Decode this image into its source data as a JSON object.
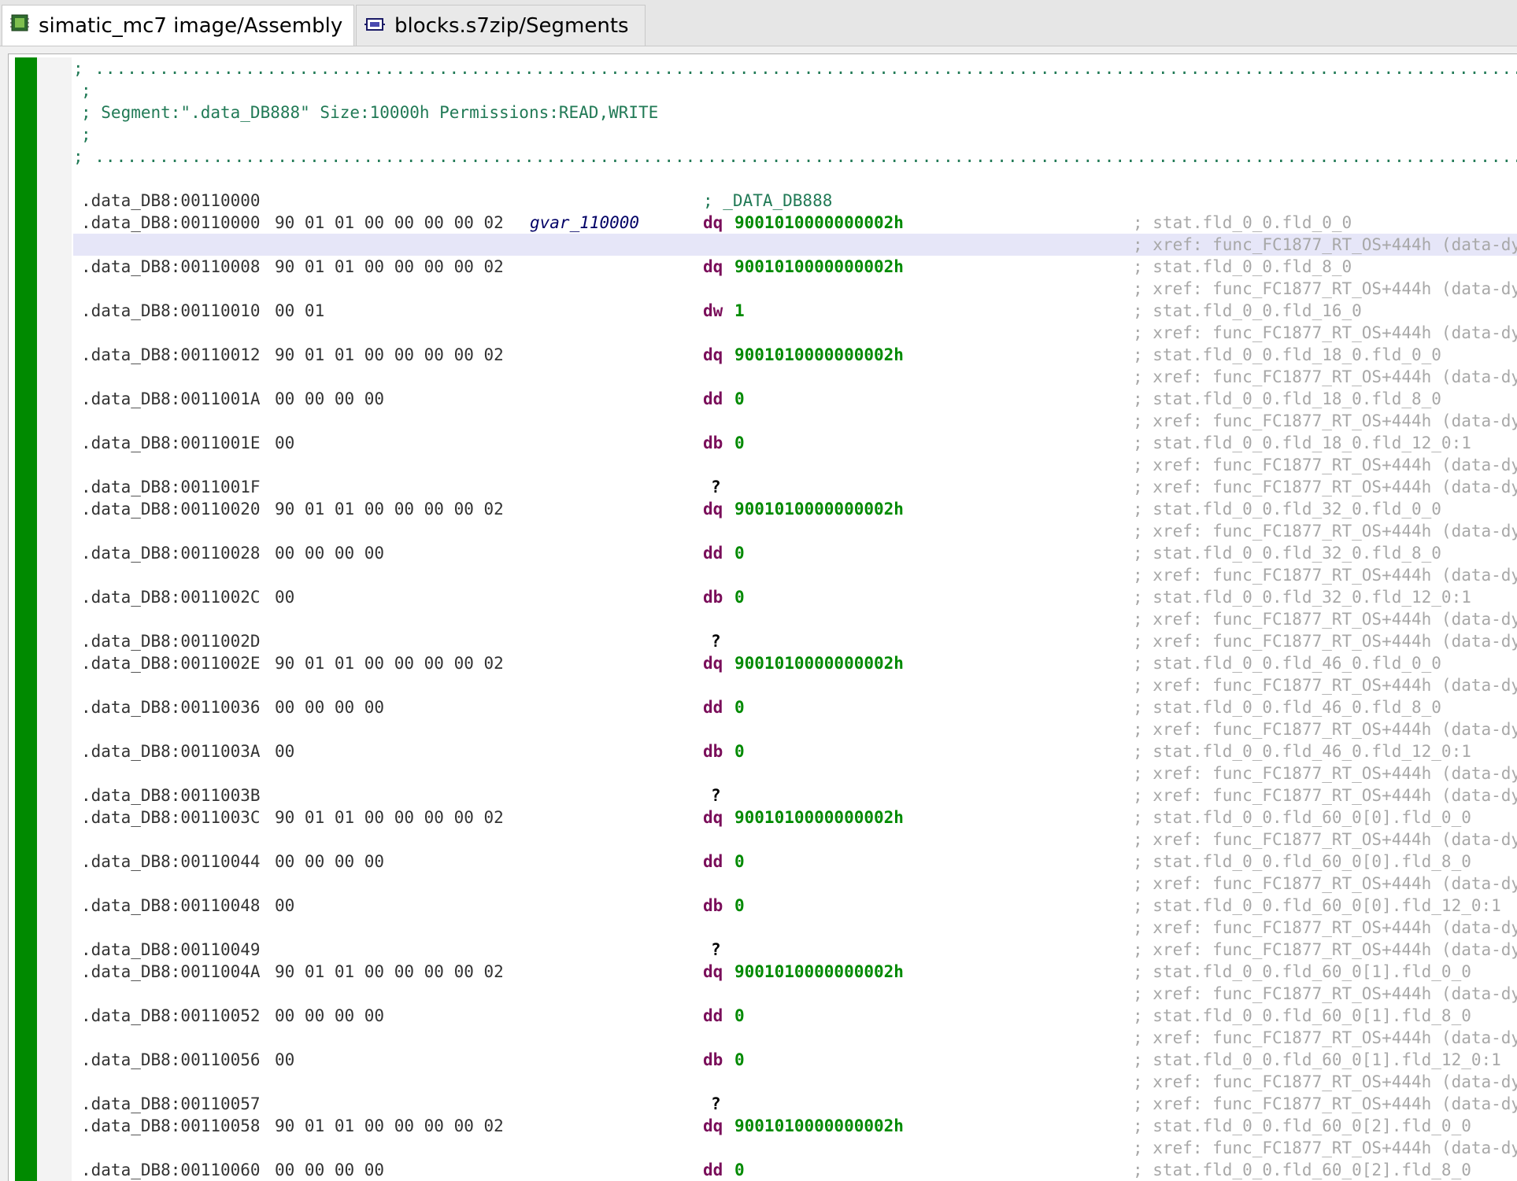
{
  "tabs": [
    {
      "label": "simatic_mc7 image/Assembly",
      "icon": "cpu-chip-icon",
      "active": true,
      "close_icon": "close-icon"
    },
    {
      "label": "blocks.s7zip/Segments",
      "icon": "segments-icon",
      "active": false
    }
  ],
  "header": {
    "dots": "; ..............................................................................................................................................",
    "semicolon": ";",
    "segment_text": "; Segment:\".data_DB888\" Size:10000h Permissions:READ,WRITE"
  },
  "section_label": "; _DATA_DB888",
  "rows": [
    {
      "addr": ".data_DB8:00110000",
      "bytes": "",
      "label": "",
      "mnem": "",
      "val": "",
      "cmt": ""
    },
    {
      "addr": ".data_DB8:00110000",
      "bytes": "90 01 01 00 00 00 00 02",
      "label": "gvar_110000",
      "mnem": "dq",
      "val": "9001010000000002h",
      "cmt": "; stat.fld_0_0.fld_0_0"
    },
    {
      "addr": "",
      "bytes": "",
      "label": "",
      "mnem": "",
      "val": "",
      "cmt": "; xref: func_FC1877_RT_OS+444h (data-dy"
    },
    {
      "addr": ".data_DB8:00110008",
      "bytes": "90 01 01 00 00 00 00 02",
      "label": "",
      "mnem": "dq",
      "val": "9001010000000002h",
      "cmt": "; stat.fld_0_0.fld_8_0"
    },
    {
      "addr": "",
      "bytes": "",
      "label": "",
      "mnem": "",
      "val": "",
      "cmt": "; xref: func_FC1877_RT_OS+444h (data-dy"
    },
    {
      "addr": ".data_DB8:00110010",
      "bytes": "00 01",
      "label": "",
      "mnem": "dw",
      "val": "1",
      "cmt": "; stat.fld_0_0.fld_16_0"
    },
    {
      "addr": "",
      "bytes": "",
      "label": "",
      "mnem": "",
      "val": "",
      "cmt": "; xref: func_FC1877_RT_OS+444h (data-dy"
    },
    {
      "addr": ".data_DB8:00110012",
      "bytes": "90 01 01 00 00 00 00 02",
      "label": "",
      "mnem": "dq",
      "val": "9001010000000002h",
      "cmt": "; stat.fld_0_0.fld_18_0.fld_0_0"
    },
    {
      "addr": "",
      "bytes": "",
      "label": "",
      "mnem": "",
      "val": "",
      "cmt": "; xref: func_FC1877_RT_OS+444h (data-dy"
    },
    {
      "addr": ".data_DB8:0011001A",
      "bytes": "00 00 00 00",
      "label": "",
      "mnem": "dd",
      "val": "0",
      "cmt": "; stat.fld_0_0.fld_18_0.fld_8_0"
    },
    {
      "addr": "",
      "bytes": "",
      "label": "",
      "mnem": "",
      "val": "",
      "cmt": "; xref: func_FC1877_RT_OS+444h (data-dy"
    },
    {
      "addr": ".data_DB8:0011001E",
      "bytes": "00",
      "label": "",
      "mnem": "db",
      "val": "0",
      "cmt": "; stat.fld_0_0.fld_18_0.fld_12_0:1"
    },
    {
      "addr": "",
      "bytes": "",
      "label": "",
      "mnem": "",
      "val": "",
      "cmt": "; xref: func_FC1877_RT_OS+444h (data-dy"
    },
    {
      "addr": ".data_DB8:0011001F",
      "bytes": "",
      "label": "",
      "mnem": "?",
      "val": "",
      "cmt": "; xref: func_FC1877_RT_OS+444h (data-dy"
    },
    {
      "addr": ".data_DB8:00110020",
      "bytes": "90 01 01 00 00 00 00 02",
      "label": "",
      "mnem": "dq",
      "val": "9001010000000002h",
      "cmt": "; stat.fld_0_0.fld_32_0.fld_0_0"
    },
    {
      "addr": "",
      "bytes": "",
      "label": "",
      "mnem": "",
      "val": "",
      "cmt": "; xref: func_FC1877_RT_OS+444h (data-dy"
    },
    {
      "addr": ".data_DB8:00110028",
      "bytes": "00 00 00 00",
      "label": "",
      "mnem": "dd",
      "val": "0",
      "cmt": "; stat.fld_0_0.fld_32_0.fld_8_0"
    },
    {
      "addr": "",
      "bytes": "",
      "label": "",
      "mnem": "",
      "val": "",
      "cmt": "; xref: func_FC1877_RT_OS+444h (data-dy"
    },
    {
      "addr": ".data_DB8:0011002C",
      "bytes": "00",
      "label": "",
      "mnem": "db",
      "val": "0",
      "cmt": "; stat.fld_0_0.fld_32_0.fld_12_0:1"
    },
    {
      "addr": "",
      "bytes": "",
      "label": "",
      "mnem": "",
      "val": "",
      "cmt": "; xref: func_FC1877_RT_OS+444h (data-dy"
    },
    {
      "addr": ".data_DB8:0011002D",
      "bytes": "",
      "label": "",
      "mnem": "?",
      "val": "",
      "cmt": "; xref: func_FC1877_RT_OS+444h (data-dy"
    },
    {
      "addr": ".data_DB8:0011002E",
      "bytes": "90 01 01 00 00 00 00 02",
      "label": "",
      "mnem": "dq",
      "val": "9001010000000002h",
      "cmt": "; stat.fld_0_0.fld_46_0.fld_0_0"
    },
    {
      "addr": "",
      "bytes": "",
      "label": "",
      "mnem": "",
      "val": "",
      "cmt": "; xref: func_FC1877_RT_OS+444h (data-dy"
    },
    {
      "addr": ".data_DB8:00110036",
      "bytes": "00 00 00 00",
      "label": "",
      "mnem": "dd",
      "val": "0",
      "cmt": "; stat.fld_0_0.fld_46_0.fld_8_0"
    },
    {
      "addr": "",
      "bytes": "",
      "label": "",
      "mnem": "",
      "val": "",
      "cmt": "; xref: func_FC1877_RT_OS+444h (data-dy"
    },
    {
      "addr": ".data_DB8:0011003A",
      "bytes": "00",
      "label": "",
      "mnem": "db",
      "val": "0",
      "cmt": "; stat.fld_0_0.fld_46_0.fld_12_0:1"
    },
    {
      "addr": "",
      "bytes": "",
      "label": "",
      "mnem": "",
      "val": "",
      "cmt": "; xref: func_FC1877_RT_OS+444h (data-dy"
    },
    {
      "addr": ".data_DB8:0011003B",
      "bytes": "",
      "label": "",
      "mnem": "?",
      "val": "",
      "cmt": "; xref: func_FC1877_RT_OS+444h (data-dy"
    },
    {
      "addr": ".data_DB8:0011003C",
      "bytes": "90 01 01 00 00 00 00 02",
      "label": "",
      "mnem": "dq",
      "val": "9001010000000002h",
      "cmt": "; stat.fld_0_0.fld_60_0[0].fld_0_0"
    },
    {
      "addr": "",
      "bytes": "",
      "label": "",
      "mnem": "",
      "val": "",
      "cmt": "; xref: func_FC1877_RT_OS+444h (data-dy"
    },
    {
      "addr": ".data_DB8:00110044",
      "bytes": "00 00 00 00",
      "label": "",
      "mnem": "dd",
      "val": "0",
      "cmt": "; stat.fld_0_0.fld_60_0[0].fld_8_0"
    },
    {
      "addr": "",
      "bytes": "",
      "label": "",
      "mnem": "",
      "val": "",
      "cmt": "; xref: func_FC1877_RT_OS+444h (data-dy"
    },
    {
      "addr": ".data_DB8:00110048",
      "bytes": "00",
      "label": "",
      "mnem": "db",
      "val": "0",
      "cmt": "; stat.fld_0_0.fld_60_0[0].fld_12_0:1"
    },
    {
      "addr": "",
      "bytes": "",
      "label": "",
      "mnem": "",
      "val": "",
      "cmt": "; xref: func_FC1877_RT_OS+444h (data-dy"
    },
    {
      "addr": ".data_DB8:00110049",
      "bytes": "",
      "label": "",
      "mnem": "?",
      "val": "",
      "cmt": "; xref: func_FC1877_RT_OS+444h (data-dy"
    },
    {
      "addr": ".data_DB8:0011004A",
      "bytes": "90 01 01 00 00 00 00 02",
      "label": "",
      "mnem": "dq",
      "val": "9001010000000002h",
      "cmt": "; stat.fld_0_0.fld_60_0[1].fld_0_0"
    },
    {
      "addr": "",
      "bytes": "",
      "label": "",
      "mnem": "",
      "val": "",
      "cmt": "; xref: func_FC1877_RT_OS+444h (data-dy"
    },
    {
      "addr": ".data_DB8:00110052",
      "bytes": "00 00 00 00",
      "label": "",
      "mnem": "dd",
      "val": "0",
      "cmt": "; stat.fld_0_0.fld_60_0[1].fld_8_0"
    },
    {
      "addr": "",
      "bytes": "",
      "label": "",
      "mnem": "",
      "val": "",
      "cmt": "; xref: func_FC1877_RT_OS+444h (data-dy"
    },
    {
      "addr": ".data_DB8:00110056",
      "bytes": "00",
      "label": "",
      "mnem": "db",
      "val": "0",
      "cmt": "; stat.fld_0_0.fld_60_0[1].fld_12_0:1"
    },
    {
      "addr": "",
      "bytes": "",
      "label": "",
      "mnem": "",
      "val": "",
      "cmt": "; xref: func_FC1877_RT_OS+444h (data-dy"
    },
    {
      "addr": ".data_DB8:00110057",
      "bytes": "",
      "label": "",
      "mnem": "?",
      "val": "",
      "cmt": "; xref: func_FC1877_RT_OS+444h (data-dy"
    },
    {
      "addr": ".data_DB8:00110058",
      "bytes": "90 01 01 00 00 00 00 02",
      "label": "",
      "mnem": "dq",
      "val": "9001010000000002h",
      "cmt": "; stat.fld_0_0.fld_60_0[2].fld_0_0"
    },
    {
      "addr": "",
      "bytes": "",
      "label": "",
      "mnem": "",
      "val": "",
      "cmt": "; xref: func_FC1877_RT_OS+444h (data-dy"
    },
    {
      "addr": ".data_DB8:00110060",
      "bytes": "00 00 00 00",
      "label": "",
      "mnem": "dd",
      "val": "0",
      "cmt": "; stat.fld_0_0.fld_60_0[2].fld_8_0"
    }
  ]
}
